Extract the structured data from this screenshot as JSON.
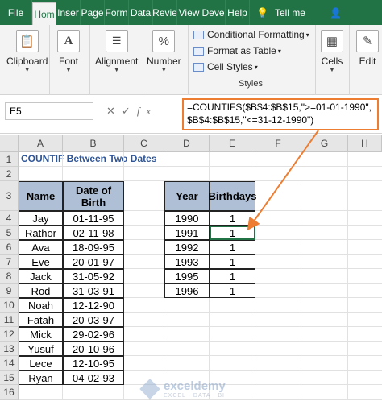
{
  "tabs": [
    "File",
    "Hom",
    "Inser",
    "Page",
    "Form",
    "Data",
    "Revie",
    "View",
    "Deve",
    "Help"
  ],
  "tell_me": "Tell me",
  "ribbon": {
    "clipboard": "Clipboard",
    "font": "Font",
    "alignment": "Alignment",
    "number": "Number",
    "number_icon": "%",
    "conditional_formatting": "Conditional Formatting",
    "format_as_table": "Format as Table",
    "cell_styles": "Cell Styles",
    "styles_group": "Styles",
    "cells": "Cells",
    "editing": "Edit"
  },
  "formula_bar": {
    "name_box": "E5",
    "fx": "fx",
    "formula_line1": "=COUNTIFS($B$4:$B$15,\">=01-01-1990\",",
    "formula_line2": "$B$4:$B$15,\"<=31-12-1990\")"
  },
  "columns": [
    "A",
    "B",
    "C",
    "D",
    "E",
    "F",
    "G",
    "H"
  ],
  "rows": [
    "1",
    "2",
    "3",
    "4",
    "5",
    "6",
    "7",
    "8",
    "9",
    "10",
    "11",
    "12",
    "13",
    "14",
    "15",
    "16"
  ],
  "sheet_title": "COUNTIF Between Two Dates",
  "table1": {
    "headers": [
      "Name",
      "Date of Birth"
    ],
    "rows": [
      [
        "Jay",
        "01-11-95"
      ],
      [
        "Rathor",
        "02-11-98"
      ],
      [
        "Ava",
        "18-09-95"
      ],
      [
        "Eve",
        "20-01-97"
      ],
      [
        "Jack",
        "31-05-92"
      ],
      [
        "Rod",
        "31-03-91"
      ],
      [
        "Noah",
        "12-12-90"
      ],
      [
        "Fatah",
        "20-03-97"
      ],
      [
        "Mick",
        "29-02-96"
      ],
      [
        "Yusuf",
        "20-10-96"
      ],
      [
        "Lece",
        "12-10-95"
      ],
      [
        "Ryan",
        "04-02-93"
      ]
    ]
  },
  "table2": {
    "headers": [
      "Year",
      "Birthdays"
    ],
    "rows": [
      [
        "1990",
        "1"
      ],
      [
        "1991",
        "1"
      ],
      [
        "1992",
        "1"
      ],
      [
        "1993",
        "1"
      ],
      [
        "1995",
        "1"
      ],
      [
        "1996",
        "1"
      ]
    ]
  },
  "watermark": {
    "name": "exceldemy",
    "tagline": "EXCEL · DATA · BI"
  },
  "colors": {
    "excel_green": "#217346",
    "header_fill": "#aebfd6",
    "arrow": "#ed7d31",
    "title": "#2e5597"
  }
}
